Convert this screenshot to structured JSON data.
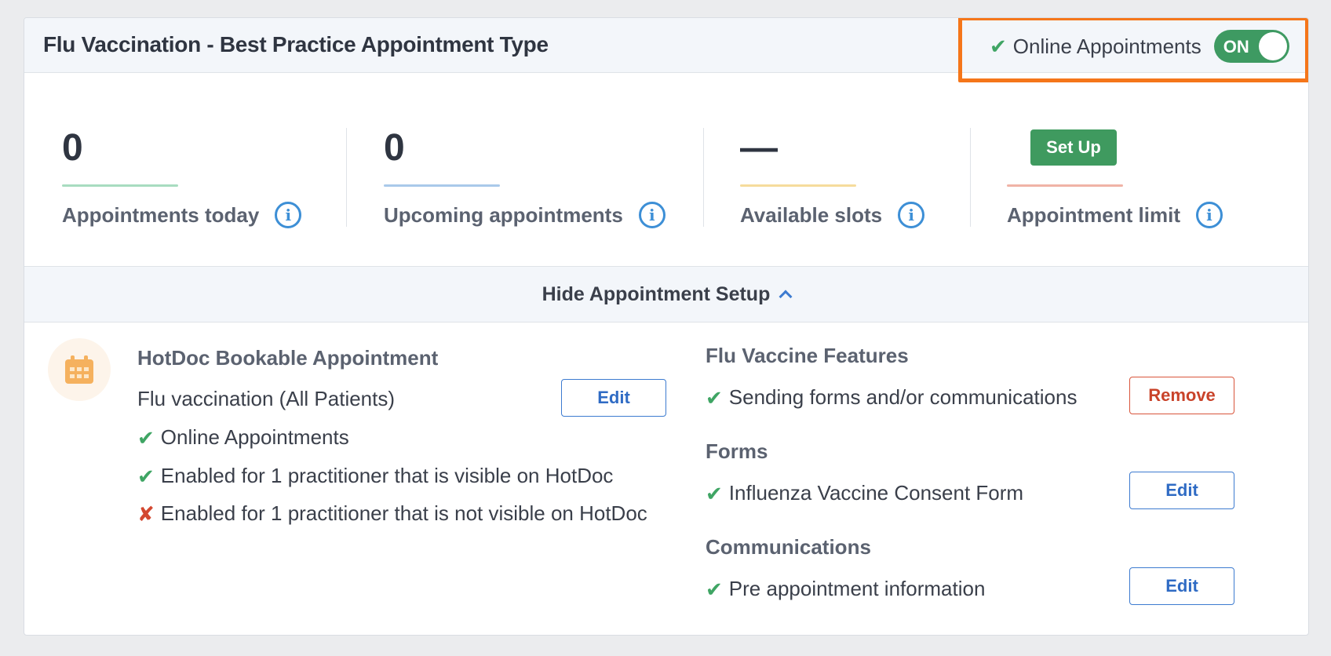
{
  "card": {
    "title": "Flu Vaccination - Best Practice Appointment Type",
    "online_toggle": {
      "label": "Online Appointments",
      "state": "ON"
    }
  },
  "stats": [
    {
      "value": "0",
      "label": "Appointments today",
      "accent": "#a8dcc0"
    },
    {
      "value": "0",
      "label": "Upcoming appointments",
      "accent": "#a9c9ea"
    },
    {
      "value": "—",
      "label": "Available slots",
      "accent": "#f6dc9c"
    },
    {
      "button": "Set Up",
      "label": "Appointment limit",
      "accent": "#f0b3a6"
    }
  ],
  "setup_toggle": {
    "label": "Hide Appointment Setup"
  },
  "bookable": {
    "title": "HotDoc Bookable Appointment",
    "appointment_name": "Flu vaccination (All Patients)",
    "edit_label": "Edit",
    "checks": [
      {
        "status": "ok",
        "text": "Online Appointments"
      },
      {
        "status": "ok",
        "text": "Enabled for 1 practitioner that is visible on HotDoc"
      },
      {
        "status": "error",
        "text": "Enabled for 1 practitioner that is not visible on HotDoc"
      }
    ]
  },
  "features": {
    "title": "Flu Vaccine Features",
    "item": "Sending forms and/or communications",
    "remove_label": "Remove"
  },
  "forms": {
    "title": "Forms",
    "item": "Influenza Vaccine Consent Form",
    "edit_label": "Edit"
  },
  "communications": {
    "title": "Communications",
    "item": "Pre appointment information",
    "edit_label": "Edit"
  },
  "colors": {
    "accent_green": "#3f9a5f",
    "highlight_orange": "#f5761a",
    "link_blue": "#2f6bc4",
    "danger_red": "#c9432a"
  }
}
